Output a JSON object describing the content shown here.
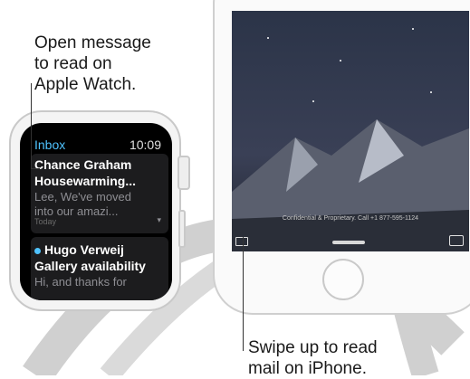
{
  "callouts": {
    "watch": [
      "Open message",
      "to read on",
      "Apple Watch."
    ],
    "phone": [
      "Swipe up to read",
      "mail on iPhone."
    ]
  },
  "watch": {
    "header": {
      "title": "Inbox",
      "time": "10:09"
    },
    "messages": [
      {
        "sender": "Chance Graham",
        "subject": "Housewarming...",
        "preview": [
          "Lee, We've moved",
          "into our amazi..."
        ],
        "date": "Today",
        "unread": false
      },
      {
        "sender": "Hugo Verweij",
        "subject": "Gallery availability",
        "preview": [
          "Hi, and thanks for"
        ],
        "unread": true
      }
    ]
  },
  "phone": {
    "legal_text": "Confidential & Proprietary. Call +1 877-595-1124",
    "icons": {
      "left": "mail-icon",
      "right": "camera-icon"
    }
  },
  "colors": {
    "accent": "#4fc3ff",
    "arc_gray": "#c9c9c9"
  }
}
